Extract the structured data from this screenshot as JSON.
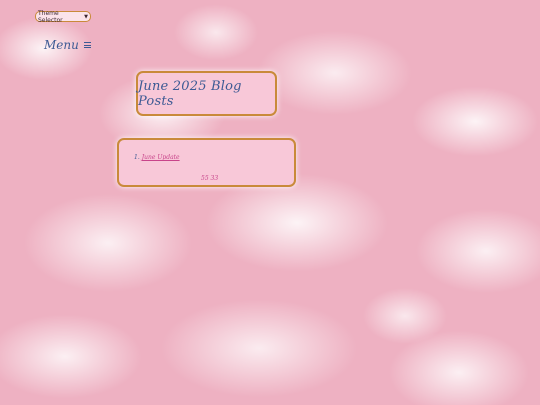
{
  "theme_selector": {
    "label": "Theme Selector"
  },
  "nav": {
    "menu_label": "Menu"
  },
  "page": {
    "title": "June 2025 Blog Posts"
  },
  "posts": [
    {
      "number": "1.",
      "title": "June Update"
    }
  ],
  "footer_count": "55 33",
  "colors": {
    "accent_text": "#3d5a94",
    "link": "#c8448a",
    "border": "#c98a3a",
    "box_bg": "#f8c8d8",
    "page_bg": "#eeb1c2"
  },
  "icons": {
    "menu": "hamburger-icon",
    "select": "chevron-down-icon"
  }
}
